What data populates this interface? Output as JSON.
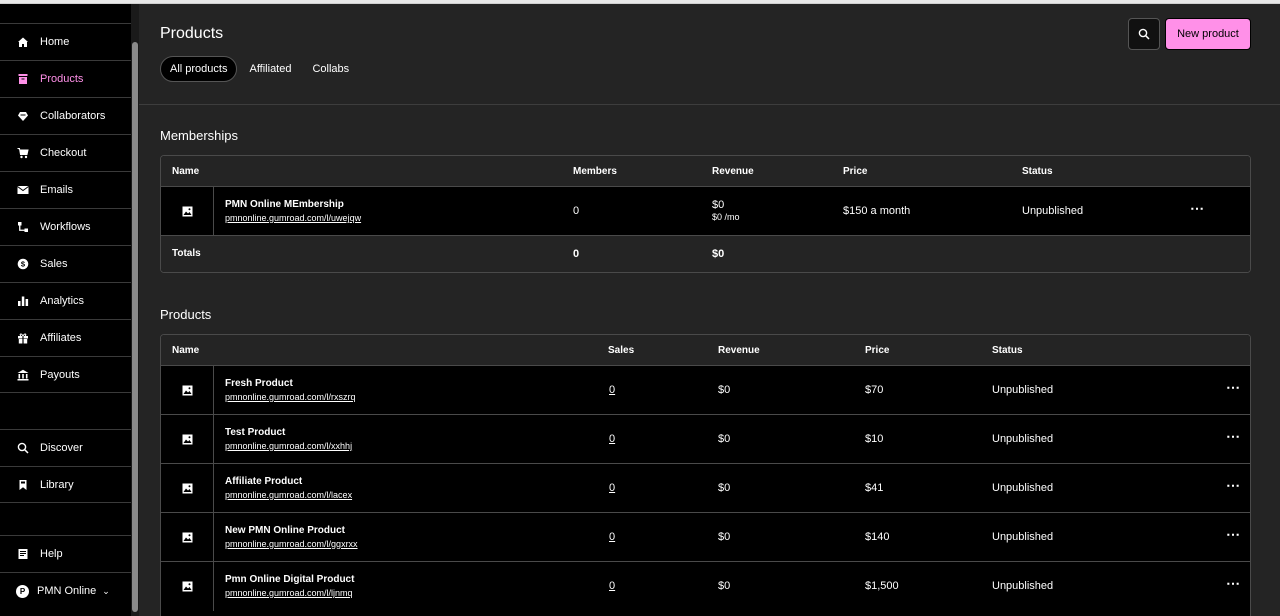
{
  "sidebar": {
    "items": [
      {
        "label": "Home",
        "icon": "home-icon"
      },
      {
        "label": "Products",
        "icon": "products-icon",
        "active": true
      },
      {
        "label": "Collaborators",
        "icon": "collaborators-icon"
      },
      {
        "label": "Checkout",
        "icon": "cart-icon"
      },
      {
        "label": "Emails",
        "icon": "mail-icon"
      },
      {
        "label": "Workflows",
        "icon": "workflow-icon"
      },
      {
        "label": "Sales",
        "icon": "dollar-icon"
      },
      {
        "label": "Analytics",
        "icon": "bar-chart-icon"
      },
      {
        "label": "Affiliates",
        "icon": "gift-icon"
      },
      {
        "label": "Payouts",
        "icon": "bank-icon"
      }
    ],
    "secondary": [
      {
        "label": "Discover",
        "icon": "search-icon"
      },
      {
        "label": "Library",
        "icon": "bookmark-icon"
      }
    ],
    "help": {
      "label": "Help",
      "icon": "help-icon"
    },
    "account": {
      "label": "PMN Online",
      "initials": "P"
    }
  },
  "header": {
    "title": "Products",
    "tabs": [
      "All products",
      "Affiliated",
      "Collabs"
    ],
    "new_button": "New product"
  },
  "memberships": {
    "title": "Memberships",
    "columns": [
      "Name",
      "Members",
      "Revenue",
      "Price",
      "Status"
    ],
    "rows": [
      {
        "name": "PMN Online MEmbership",
        "url": "pmnonline.gumroad.com/l/uwejqw",
        "members": "0",
        "revenue": "$0",
        "revenue_sub": "$0 /mo",
        "price": "$150 a month",
        "status": "Unpublished"
      }
    ],
    "totals": {
      "label": "Totals",
      "members": "0",
      "revenue": "$0"
    }
  },
  "products": {
    "title": "Products",
    "columns": [
      "Name",
      "Sales",
      "Revenue",
      "Price",
      "Status"
    ],
    "rows": [
      {
        "name": "Fresh Product",
        "url": "pmnonline.gumroad.com/l/rxszrq",
        "sales": "0",
        "revenue": "$0",
        "price": "$70",
        "status": "Unpublished"
      },
      {
        "name": "Test Product",
        "url": "pmnonline.gumroad.com/l/xxhhj",
        "sales": "0",
        "revenue": "$0",
        "price": "$10",
        "status": "Unpublished"
      },
      {
        "name": "Affiliate Product",
        "url": "pmnonline.gumroad.com/l/lacex",
        "sales": "0",
        "revenue": "$0",
        "price": "$41",
        "status": "Unpublished"
      },
      {
        "name": "New PMN Online Product",
        "url": "pmnonline.gumroad.com/l/ggxrxx",
        "sales": "0",
        "revenue": "$0",
        "price": "$140",
        "status": "Unpublished"
      },
      {
        "name": "Pmn Online Digital Product",
        "url": "pmnonline.gumroad.com/l/ljnmq",
        "sales": "0",
        "revenue": "$0",
        "price": "$1,500",
        "status": "Unpublished"
      }
    ]
  },
  "colors": {
    "accent": "#ff90e8",
    "background": "#242424",
    "sidebar": "#000000"
  }
}
